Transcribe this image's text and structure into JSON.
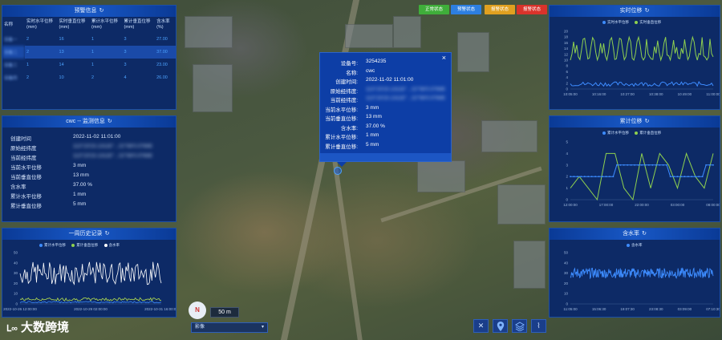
{
  "status_buttons": [
    {
      "label": "正常状态",
      "color": "#3fae3a"
    },
    {
      "label": "预警状态",
      "color": "#2d7fe0"
    },
    {
      "label": "报警状态",
      "color": "#e0a020"
    },
    {
      "label": "报警状态",
      "color": "#d9332b"
    }
  ],
  "warning_panel": {
    "title": "预警信息",
    "headers": [
      "名称",
      "实时水平位移(mm)",
      "实时垂直位移(mm)",
      "累计水平位移(mm)",
      "累计垂直位移(mm)",
      "含水率(%)"
    ],
    "rows": [
      {
        "name": "设备一",
        "values": [
          "2",
          "16",
          "1",
          "3",
          "27.00"
        ]
      },
      {
        "name": "设备二",
        "values": [
          "2",
          "13",
          "1",
          "3",
          "37.00"
        ]
      },
      {
        "name": "设备三",
        "values": [
          "1",
          "14",
          "1",
          "3",
          "23.00"
        ]
      },
      {
        "name": "设备四",
        "values": [
          "2",
          "10",
          "2",
          "4",
          "26.00"
        ]
      }
    ]
  },
  "monitor_panel": {
    "title": "cwc -- 监测信息",
    "items": [
      {
        "label": "创建时间",
        "value": "2022-11-02 11:01:00",
        "blur": false
      },
      {
        "label": "原始经纬度",
        "value": "113°23'23.1311E° , 22°58'0.0768E",
        "blur": true
      },
      {
        "label": "当前经纬度",
        "value": "113°23'23.1311E° , 22°58'0.0768E",
        "blur": true
      },
      {
        "label": "当前水平位移",
        "value": "3 mm",
        "blur": false
      },
      {
        "label": "当前垂直位移",
        "value": "13 mm",
        "blur": false
      },
      {
        "label": "含水率",
        "value": "37.00 %",
        "blur": false
      },
      {
        "label": "累计水平位移",
        "value": "1 mm",
        "blur": false
      },
      {
        "label": "累计垂直位移",
        "value": "5 mm",
        "blur": false
      }
    ]
  },
  "history_panel": {
    "title": "一周历史记录",
    "legend": [
      "累计水平位移",
      "累计垂直位移",
      "含水率"
    ],
    "y_ticks": [
      "50",
      "40",
      "30",
      "20",
      "10",
      "0"
    ],
    "x_ticks": [
      "2022-10-26 12:00:00",
      "2022-10-29 02:00:00",
      "2022-10-31 16:00:00"
    ]
  },
  "realtime_panel": {
    "title": "实时位移",
    "legend": [
      "实时水平位移",
      "实时垂直位移"
    ],
    "y_ticks": [
      "20",
      "18",
      "16",
      "14",
      "12",
      "10",
      "8",
      "6",
      "4",
      "2",
      "0"
    ],
    "x_ticks": [
      "10:05:00",
      "10:16:00",
      "10:27:00",
      "10:38:00",
      "10:49:00",
      "11:00:00"
    ]
  },
  "cumulative_panel": {
    "title": "累计位移",
    "legend": [
      "累计水平位移",
      "累计垂直位移"
    ],
    "y_ticks": [
      "5",
      "4",
      "3",
      "2",
      "1",
      "0"
    ],
    "x_ticks": [
      "12:00:00",
      "17:00:00",
      "22:00:00",
      "03:00:00",
      "08:00:00"
    ]
  },
  "water_panel": {
    "title": "含水率",
    "legend": [
      "含水率"
    ],
    "y_ticks": [
      "50",
      "40",
      "30",
      "20",
      "10",
      "0"
    ],
    "x_ticks": [
      "11:05:00",
      "15:06:30",
      "19:07:30",
      "23:08:30",
      "03:09:00",
      "07:10:30"
    ]
  },
  "popup": {
    "rows": [
      {
        "label": "设备号:",
        "value": "3254235",
        "blur": false
      },
      {
        "label": "名称:",
        "value": "cwc",
        "blur": false
      },
      {
        "label": "创建时间:",
        "value": "2022-11-02 11:01:00",
        "blur": false
      },
      {
        "label": "原始经纬度:",
        "value": "113°23'23.1311E° , 22°58'0.0768E",
        "blur": true
      },
      {
        "label": "当前经纬度:",
        "value": "113°23'23.1311E° , 22°58'0.0768E",
        "blur": true
      },
      {
        "label": "当前水平位移:",
        "value": "3 mm",
        "blur": false
      },
      {
        "label": "当前垂直位移:",
        "value": "13 mm",
        "blur": false
      },
      {
        "label": "含水率:",
        "value": "37.00 %",
        "blur": false
      },
      {
        "label": "累计水平位移:",
        "value": "1 mm",
        "blur": false
      },
      {
        "label": "累计垂直位移:",
        "value": "5 mm",
        "blur": false
      }
    ],
    "close": "×"
  },
  "map": {
    "scale": "50 m",
    "layer_select": "影像",
    "compass": "N"
  },
  "watermark": "大数跨境"
}
